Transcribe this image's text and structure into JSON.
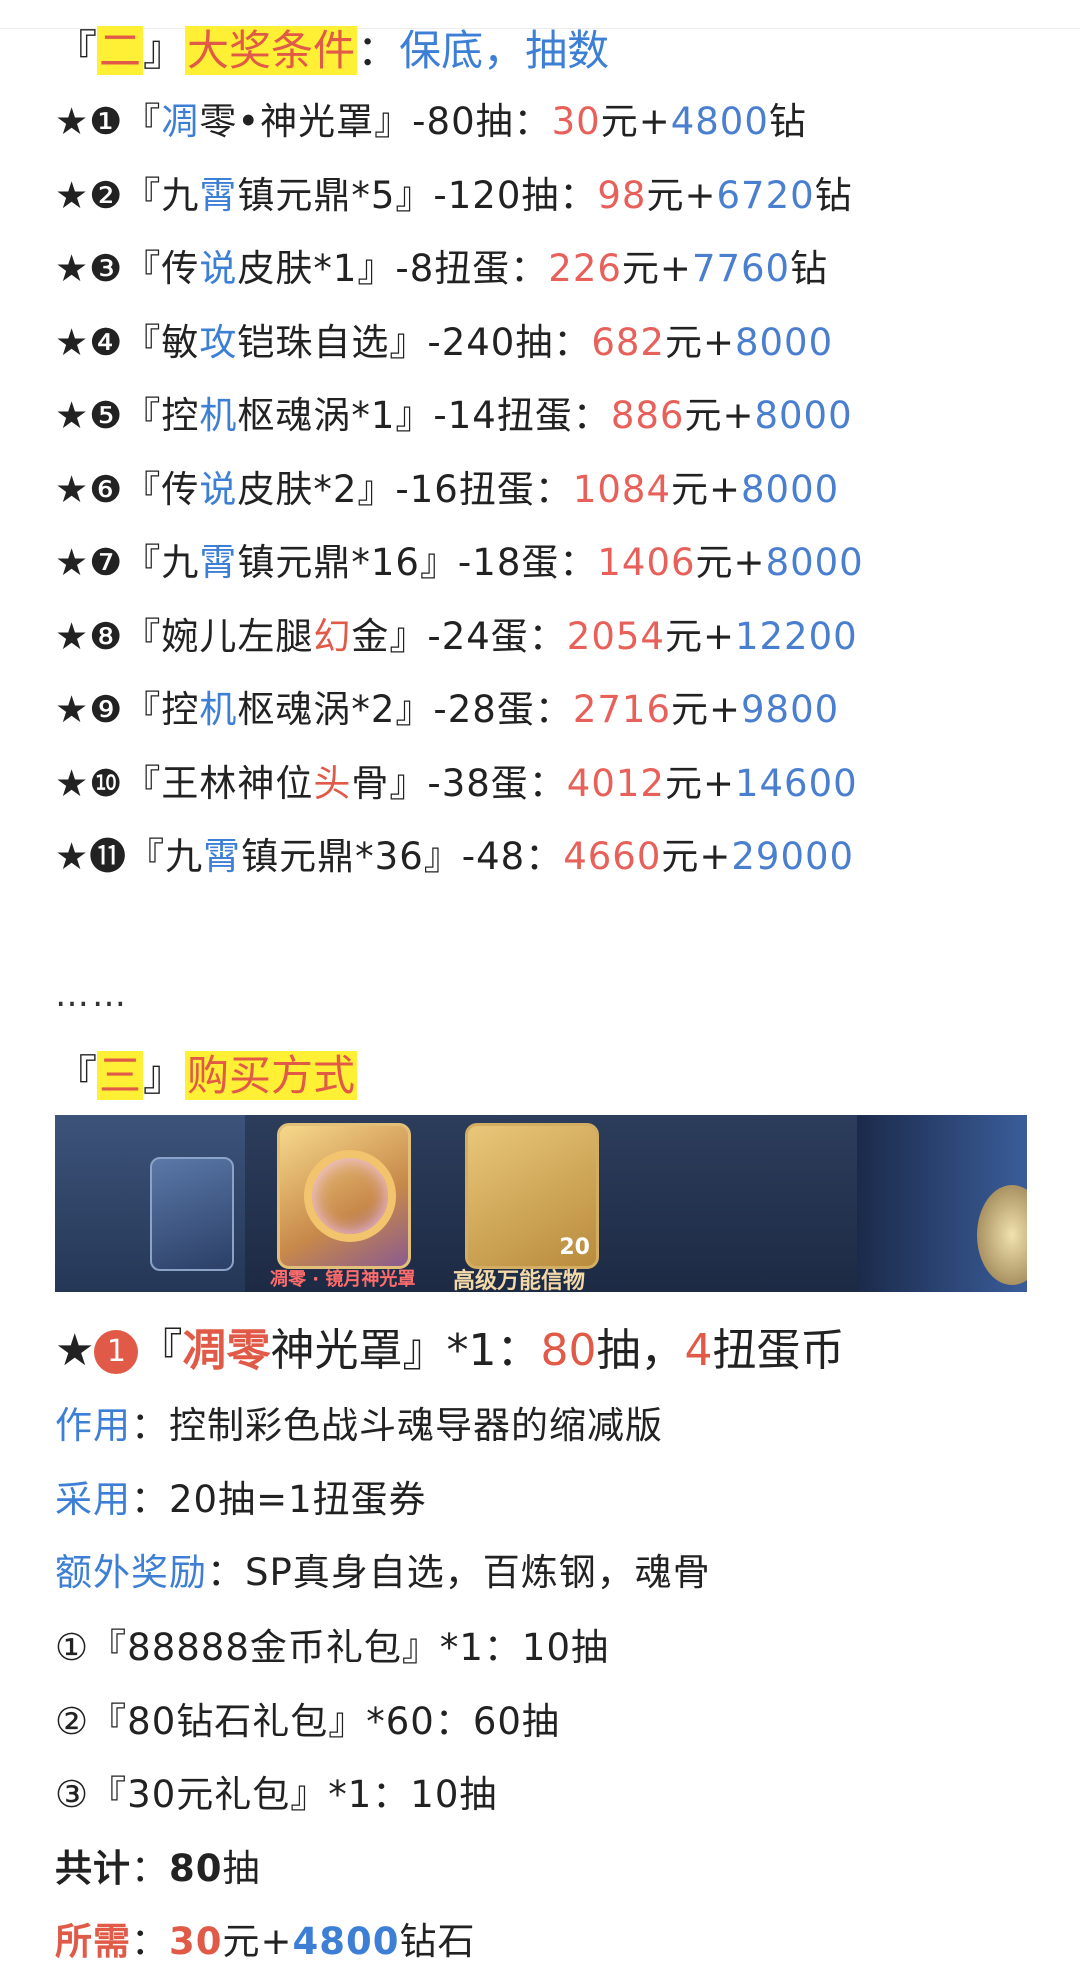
{
  "section2": {
    "open": "『",
    "num": "二",
    "close": "』",
    "title": "大奖条件",
    "colon": "：",
    "subtitle": "保底，抽数"
  },
  "prizes": [
    {
      "prefix": "★❶『",
      "a": "凋",
      "b": "零•神光罩",
      "c": "』-80抽：",
      "price": "30",
      "yuan": "元+",
      "diamonds": "4800",
      "suffix": "钻"
    },
    {
      "prefix": "★❷『九",
      "a": "霄",
      "b": "镇元鼎*5",
      "c": "』-120抽：",
      "price": "98",
      "yuan": "元+",
      "diamonds": "6720",
      "suffix": "钻"
    },
    {
      "prefix": "★❸『传",
      "a": "说",
      "b": "皮肤*1",
      "c": "』-8扭蛋：",
      "price": "226",
      "yuan": "元+",
      "diamonds": "7760",
      "suffix": "钻"
    },
    {
      "prefix": "★❹『敏",
      "a": "攻",
      "b": "铠珠自选",
      "c": "』-240抽：",
      "price": "682",
      "yuan": "元+",
      "diamonds": "8000",
      "suffix": ""
    },
    {
      "prefix": "★❺『控",
      "a": "机",
      "b": "枢魂涡*1",
      "c": "』-14扭蛋：",
      "price": "886",
      "yuan": "元+",
      "diamonds": "8000",
      "suffix": ""
    },
    {
      "prefix": "★❻『传",
      "a": "说",
      "b": "皮肤*2",
      "c": "』-16扭蛋：",
      "price": "1084",
      "yuan": "元+",
      "diamonds": "8000",
      "suffix": ""
    },
    {
      "prefix": "★❼『九",
      "a": "霄",
      "b": "镇元鼎*16",
      "c": "』-18蛋：",
      "price": "1406",
      "yuan": "元+",
      "diamonds": "8000",
      "suffix": ""
    },
    {
      "prefix": "★❽『婉儿左腿",
      "a": "幻",
      "b": "金",
      "c": "』-24蛋：",
      "price": "2054",
      "yuan": "元+",
      "diamonds": "12200",
      "suffix": "",
      "a_red": true
    },
    {
      "prefix": "★❾『控",
      "a": "机",
      "b": "枢魂涡*2",
      "c": "』-28蛋：",
      "price": "2716",
      "yuan": "元+",
      "diamonds": "9800",
      "suffix": ""
    },
    {
      "prefix": "★❿『王林神位",
      "a": "头",
      "b": "骨",
      "c": "』-38蛋：",
      "price": "4012",
      "yuan": "元+",
      "diamonds": "14600",
      "suffix": "",
      "a_red": true
    },
    {
      "prefix": "★⓫『九",
      "a": "霄",
      "b": "镇元鼎*36",
      "c": "』-48：",
      "price": "4660",
      "yuan": "元+",
      "diamonds": "29000",
      "suffix": ""
    }
  ],
  "ellipsis": "……",
  "section3": {
    "open": "『",
    "num": "三",
    "close": "』",
    "title": "购买方式"
  },
  "banner": {
    "caption1": "凋零 · 镜月神光罩",
    "caption2": "高级万能信物",
    "badge": "20"
  },
  "item": {
    "star": "★",
    "num": "1",
    "open": "『",
    "name": "凋零",
    "name2": "神光罩",
    "qty": "』*1：",
    "pulls": "80",
    "pulls_unit": "抽，",
    "coins": "4",
    "coins_unit": "扭蛋币"
  },
  "details": [
    {
      "label": "作用",
      "text": "：控制彩色战斗魂导器的缩减版"
    },
    {
      "label": "采用",
      "text": "：20抽=1扭蛋券"
    },
    {
      "label": "额外奖励",
      "text": "：SP真身自选，百炼钢，魂骨"
    }
  ],
  "packs": [
    "①『88888金币礼包』*1：10抽",
    "②『80钻石礼包』*60：60抽",
    "③『30元礼包』*1：10抽"
  ],
  "total": {
    "label": "共计",
    "colon": "：",
    "value": "80",
    "unit": "抽"
  },
  "required": {
    "label": "所需",
    "colon": "：",
    "price": "30",
    "yuan": "元+",
    "diamonds": "4800",
    "unit": "钻石"
  }
}
